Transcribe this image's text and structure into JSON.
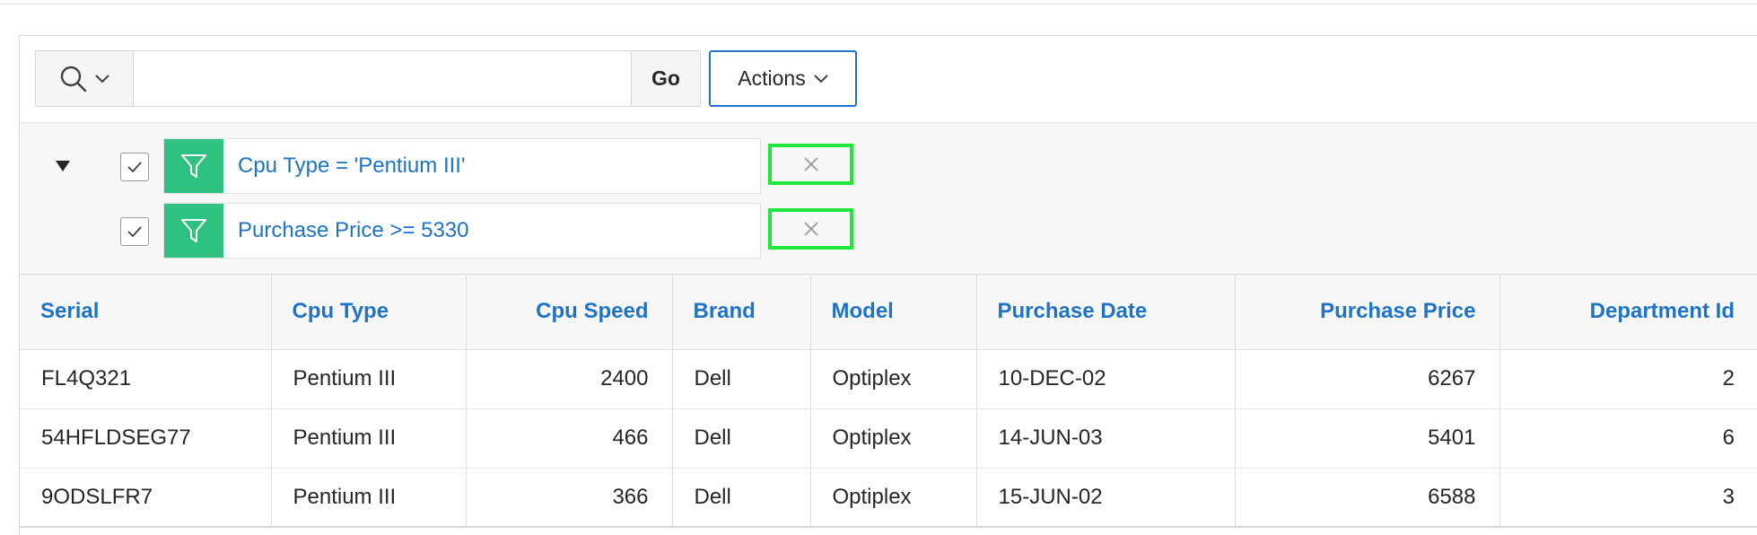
{
  "search": {
    "placeholder": "",
    "value": "",
    "menu_icon": "search-icon",
    "go_label": "Go"
  },
  "actions": {
    "label": "Actions"
  },
  "filters": [
    {
      "enabled": true,
      "icon": "filter-icon",
      "label": "Cpu Type = 'Pentium III'"
    },
    {
      "enabled": true,
      "icon": "filter-icon",
      "label": "Purchase Price >= 5330"
    }
  ],
  "table": {
    "columns": [
      "Serial",
      "Cpu Type",
      "Cpu Speed",
      "Brand",
      "Model",
      "Purchase Date",
      "Purchase Price",
      "Department Id"
    ],
    "rows": [
      [
        "FL4Q321",
        "Pentium III",
        "2400",
        "Dell",
        "Optiplex",
        "10-DEC-02",
        "6267",
        "2"
      ],
      [
        "54HFLDSEG77",
        "Pentium III",
        "466",
        "Dell",
        "Optiplex",
        "14-JUN-03",
        "5401",
        "6"
      ],
      [
        "9ODSLFR7",
        "Pentium III",
        "366",
        "Dell",
        "Optiplex",
        "15-JUN-02",
        "6588",
        "3"
      ]
    ]
  },
  "colors": {
    "accent": "#1f73c7",
    "filter_green": "#2fc17f",
    "highlight_green": "#22e63b"
  }
}
